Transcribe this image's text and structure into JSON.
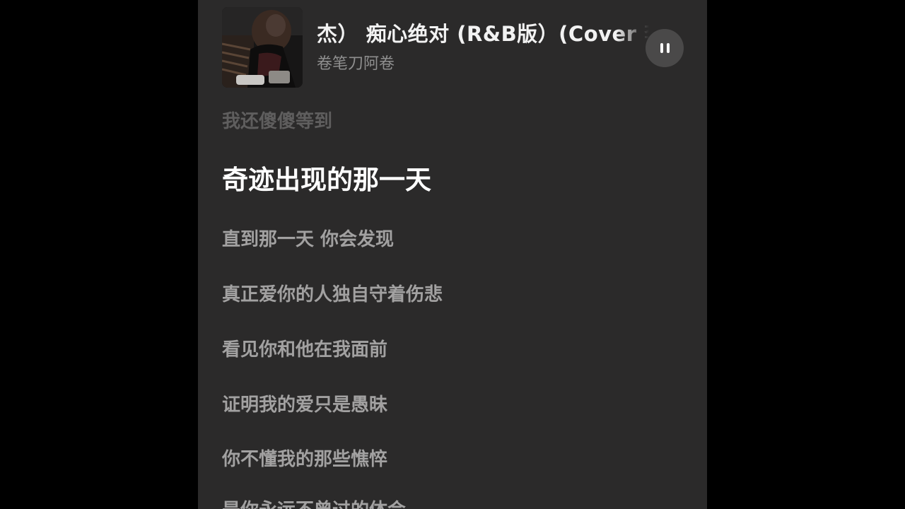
{
  "player": {
    "track_title": "杰） 痴心绝对 (R&B版）(Cover 李圣杰)",
    "artist": "卷笔刀阿卷",
    "pause_icon": "pause-icon",
    "colors": {
      "background": "#2b2a2a",
      "active_lyric": "#ffffff",
      "inactive_lyric": "#a2a1a1",
      "past_lyric": "#5f5e5e"
    }
  },
  "lyrics": {
    "lines": [
      "我还傻傻等到",
      "奇迹出现的那一天",
      "直到那一天 你会发现",
      "真正爱你的人独自守着伤悲",
      "看见你和他在我面前",
      "证明我的爱只是愚昧",
      "你不懂我的那些憔悴",
      "是你永远不曾过的体会"
    ]
  }
}
